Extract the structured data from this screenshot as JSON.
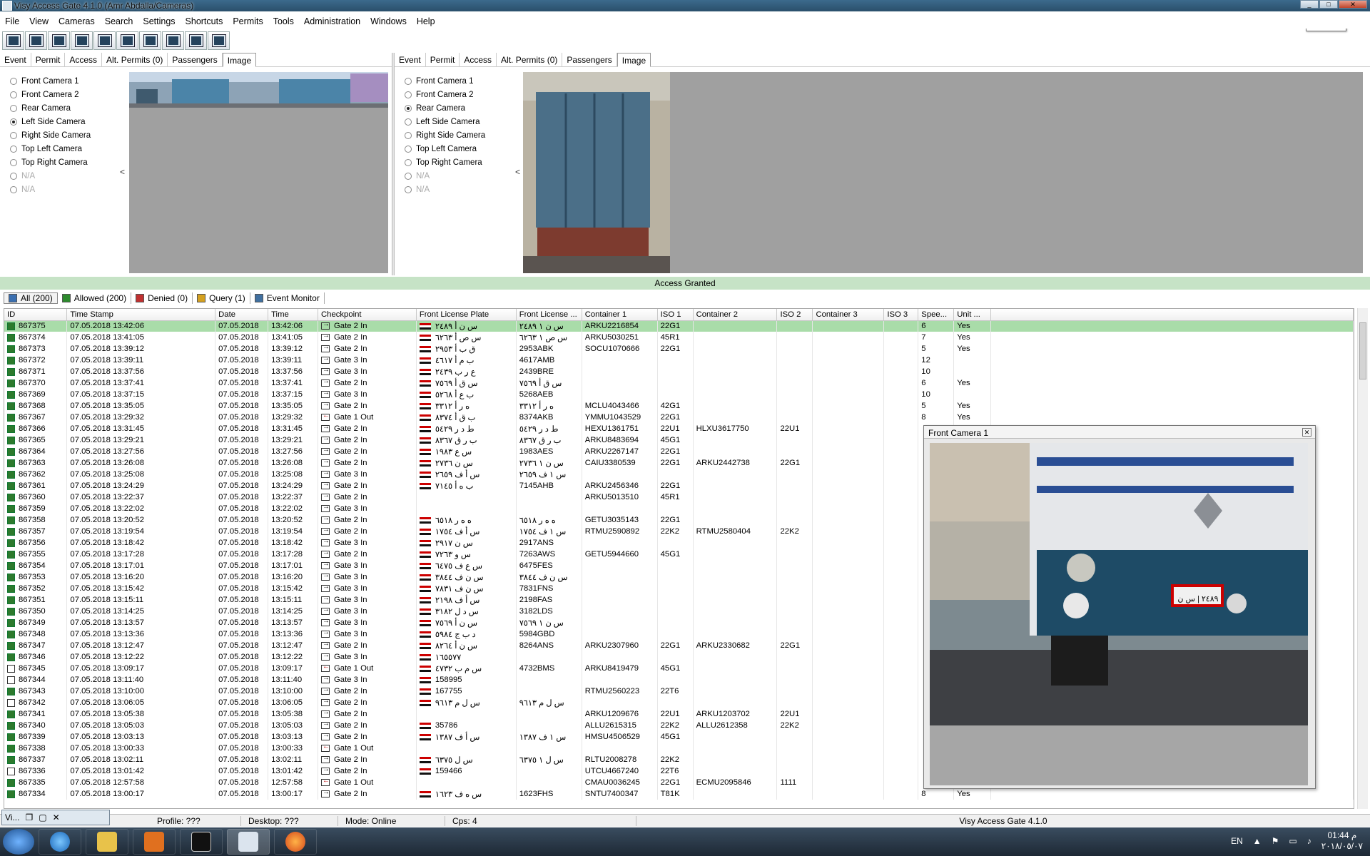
{
  "window": {
    "title": "Visy Access Gate 4.1.0 (Amr Abdalla/Cameras)",
    "tooltip": "Minimize"
  },
  "menu": [
    "File",
    "View",
    "Cameras",
    "Search",
    "Settings",
    "Shortcuts",
    "Permits",
    "Tools",
    "Administration",
    "Windows",
    "Help"
  ],
  "toolbar_icons": [
    "toolbar-icon-1",
    "toolbar-icon-2",
    "toolbar-icon-3",
    "toolbar-icon-4",
    "toolbar-icon-5",
    "toolbar-icon-6",
    "toolbar-icon-7",
    "toolbar-icon-8",
    "toolbar-icon-9",
    "toolbar-icon-10"
  ],
  "left_panel": {
    "tabs": [
      "Event",
      "Permit",
      "Access",
      "Alt. Permits (0)",
      "Passengers",
      "Image"
    ],
    "active_tab": "Image",
    "cameras": [
      "Front Camera 1",
      "Front Camera 2",
      "Rear Camera",
      "Left Side Camera",
      "Right Side Camera",
      "Top Left Camera",
      "Top Right Camera",
      "N/A",
      "N/A"
    ],
    "selected": "Left Side Camera"
  },
  "right_panel": {
    "tabs": [
      "Event",
      "Permit",
      "Access",
      "Alt. Permits (0)",
      "Passengers",
      "Image"
    ],
    "active_tab": "Image",
    "cameras": [
      "Front Camera 1",
      "Front Camera 2",
      "Rear Camera",
      "Left Side Camera",
      "Right Side Camera",
      "Top Left Camera",
      "Top Right Camera",
      "N/A",
      "N/A"
    ],
    "selected": "Rear Camera"
  },
  "collapse_glyph": "<",
  "banner": "Access Granted",
  "filters": [
    "All  (200)",
    "Allowed (200)",
    "Denied (0)",
    "Query (1)",
    "Event Monitor"
  ],
  "columns": [
    "ID",
    "Time Stamp",
    "Date",
    "Time",
    "Checkpoint",
    "Front License Plate",
    "Front License ...",
    "Container 1",
    "ISO 1",
    "Container 2",
    "ISO 2",
    "Container 3",
    "ISO 3",
    "Spee...",
    "Unit ..."
  ],
  "rows": [
    [
      "867375",
      "07.05.2018 13:42:06",
      "07.05.2018",
      "13:42:06",
      "Gate 2 In",
      "س ن أ ٢٤٨٩",
      "س ن ١ ٢٤٨٩",
      "ARKU2216854",
      "22G1",
      "",
      "",
      "",
      "",
      "6",
      "Yes"
    ],
    [
      "867374",
      "07.05.2018 13:41:05",
      "07.05.2018",
      "13:41:05",
      "Gate 2 In",
      "س ص أ ٦٢٦٣",
      "س ص ١ ٦٢٦٣",
      "ARKU5030251",
      "45R1",
      "",
      "",
      "",
      "",
      "7",
      "Yes"
    ],
    [
      "867373",
      "07.05.2018 13:39:12",
      "07.05.2018",
      "13:39:12",
      "Gate 2 In",
      "ق ب أ ٢٩٥٣",
      "2953ABK",
      "SOCU1070666",
      "22G1",
      "",
      "",
      "",
      "",
      "5",
      "Yes"
    ],
    [
      "867372",
      "07.05.2018 13:39:11",
      "07.05.2018",
      "13:39:11",
      "Gate 3 In",
      "ب م أ ٤٦١٧",
      "4617AMB",
      "",
      "",
      "",
      "",
      "",
      "",
      "12",
      ""
    ],
    [
      "867371",
      "07.05.2018 13:37:56",
      "07.05.2018",
      "13:37:56",
      "Gate 3 In",
      "ع ر ب ٢٤٣٩",
      "2439BRE",
      "",
      "",
      "",
      "",
      "",
      "",
      "10",
      ""
    ],
    [
      "867370",
      "07.05.2018 13:37:41",
      "07.05.2018",
      "13:37:41",
      "Gate 2 In",
      "س ق أ ٧٥٦٩",
      "س ق أ ٧٥٦٩",
      "",
      "",
      "",
      "",
      "",
      "",
      "6",
      "Yes"
    ],
    [
      "867369",
      "07.05.2018 13:37:15",
      "07.05.2018",
      "13:37:15",
      "Gate 3 In",
      "ب ع أ ٥٢٦٨",
      "5268AEB",
      "",
      "",
      "",
      "",
      "",
      "",
      "10",
      ""
    ],
    [
      "867368",
      "07.05.2018 13:35:05",
      "07.05.2018",
      "13:35:05",
      "Gate 2 In",
      "ه ر أ ٣٣١٢",
      "ه ر أ ٣٣١٢",
      "MCLU4043466",
      "42G1",
      "",
      "",
      "",
      "",
      "5",
      "Yes"
    ],
    [
      "867367",
      "07.05.2018 13:29:32",
      "07.05.2018",
      "13:29:32",
      "Gate 1 Out",
      "ب ق أ ٨٣٧٤",
      "8374AKB",
      "YMMU1043529",
      "22G1",
      "",
      "",
      "",
      "",
      "8",
      "Yes"
    ],
    [
      "867366",
      "07.05.2018 13:31:45",
      "07.05.2018",
      "13:31:45",
      "Gate 2 In",
      "ط د ر ٥٤٢٩",
      "ط د ر ٥٤٢٩",
      "HEXU1361751",
      "22U1",
      "HLXU3617750",
      "22U1",
      "",
      "",
      "",
      ""
    ],
    [
      "867365",
      "07.05.2018 13:29:21",
      "07.05.2018",
      "13:29:21",
      "Gate 2 In",
      "ب ر ق ٨٣٦٧",
      "ب ر ق ٨٣٦٧",
      "ARKU8483694",
      "45G1",
      "",
      "",
      "",
      "",
      "",
      ""
    ],
    [
      "867364",
      "07.05.2018 13:27:56",
      "07.05.2018",
      "13:27:56",
      "Gate 2 In",
      "س ع ١٩٨٣",
      "1983AES",
      "ARKU2267147",
      "22G1",
      "",
      "",
      "",
      "",
      "",
      ""
    ],
    [
      "867363",
      "07.05.2018 13:26:08",
      "07.05.2018",
      "13:26:08",
      "Gate 2 In",
      "س ن ٢٧٣٦",
      "س ن ١ ٢٧٣٦",
      "CAIU3380539",
      "22G1",
      "ARKU2442738",
      "22G1",
      "",
      "",
      "",
      ""
    ],
    [
      "867362",
      "07.05.2018 13:25:08",
      "07.05.2018",
      "13:25:08",
      "Gate 3 In",
      "س أ ف ٢٦٥٩",
      "س ١ ف ٢٦٥٩",
      "",
      "",
      "",
      "",
      "",
      "",
      "",
      ""
    ],
    [
      "867361",
      "07.05.2018 13:24:29",
      "07.05.2018",
      "13:24:29",
      "Gate 2 In",
      "ب ه أ ٧١٤٥",
      "7145AHB",
      "ARKU2456346",
      "22G1",
      "",
      "",
      "",
      "",
      "",
      ""
    ],
    [
      "867360",
      "07.05.2018 13:22:37",
      "07.05.2018",
      "13:22:37",
      "Gate 2 In",
      "",
      "",
      "ARKU5013510",
      "45R1",
      "",
      "",
      "",
      "",
      "",
      ""
    ],
    [
      "867359",
      "07.05.2018 13:22:02",
      "07.05.2018",
      "13:22:02",
      "Gate 3 In",
      "",
      "",
      "",
      "",
      "",
      "",
      "",
      "",
      "",
      ""
    ],
    [
      "867358",
      "07.05.2018 13:20:52",
      "07.05.2018",
      "13:20:52",
      "Gate 2 In",
      "ه ه ر ٦٥١٨",
      "ه ه ر ٦٥١٨",
      "GETU3035143",
      "22G1",
      "",
      "",
      "",
      "",
      "",
      ""
    ],
    [
      "867357",
      "07.05.2018 13:19:54",
      "07.05.2018",
      "13:19:54",
      "Gate 2 In",
      "س أ ف ١٧٥٤",
      "س ١ ف ١٧٥٤",
      "RTMU2590892",
      "22K2",
      "RTMU2580404",
      "22K2",
      "",
      "",
      "",
      ""
    ],
    [
      "867356",
      "07.05.2018 13:18:42",
      "07.05.2018",
      "13:18:42",
      "Gate 3 In",
      "س ن ٢٩١٧",
      "2917ANS",
      "",
      "",
      "",
      "",
      "",
      "",
      "",
      ""
    ],
    [
      "867355",
      "07.05.2018 13:17:28",
      "07.05.2018",
      "13:17:28",
      "Gate 2 In",
      "س و ٧٢٦٣",
      "7263AWS",
      "GETU5944660",
      "45G1",
      "",
      "",
      "",
      "",
      "",
      ""
    ],
    [
      "867354",
      "07.05.2018 13:17:01",
      "07.05.2018",
      "13:17:01",
      "Gate 3 In",
      "س ع ف ٦٤٧٥",
      "6475FES",
      "",
      "",
      "",
      "",
      "",
      "",
      "",
      ""
    ],
    [
      "867353",
      "07.05.2018 13:16:20",
      "07.05.2018",
      "13:16:20",
      "Gate 3 In",
      "س ن ف ٣٨٤٤",
      "س ن ف ٣٨٤٤",
      "",
      "",
      "",
      "",
      "",
      "",
      "",
      ""
    ],
    [
      "867352",
      "07.05.2018 13:15:42",
      "07.05.2018",
      "13:15:42",
      "Gate 3 In",
      "س ن ف ٧٨٣١",
      "7831FNS",
      "",
      "",
      "",
      "",
      "",
      "",
      "",
      ""
    ],
    [
      "867351",
      "07.05.2018 13:15:11",
      "07.05.2018",
      "13:15:11",
      "Gate 3 In",
      "س أ ف ٢١٩٨",
      "2198FAS",
      "",
      "",
      "",
      "",
      "",
      "",
      "",
      ""
    ],
    [
      "867350",
      "07.05.2018 13:14:25",
      "07.05.2018",
      "13:14:25",
      "Gate 3 In",
      "س د ل ٣١٨٢",
      "3182LDS",
      "",
      "",
      "",
      "",
      "",
      "",
      "",
      ""
    ],
    [
      "867349",
      "07.05.2018 13:13:57",
      "07.05.2018",
      "13:13:57",
      "Gate 3 In",
      "س ن أ ٧٥٦٩",
      "س ن ١ ٧٥٦٩",
      "",
      "",
      "",
      "",
      "",
      "",
      "",
      ""
    ],
    [
      "867348",
      "07.05.2018 13:13:36",
      "07.05.2018",
      "13:13:36",
      "Gate 3 In",
      "د ب ج ٥٩٨٤",
      "5984GBD",
      "",
      "",
      "",
      "",
      "",
      "",
      "",
      ""
    ],
    [
      "867347",
      "07.05.2018 13:12:47",
      "07.05.2018",
      "13:12:47",
      "Gate 2 In",
      "س ن أ ٨٢٦٤",
      "8264ANS",
      "ARKU2307960",
      "22G1",
      "ARKU2330682",
      "22G1",
      "",
      "",
      "",
      ""
    ],
    [
      "867346",
      "07.05.2018 13:12:22",
      "07.05.2018",
      "13:12:22",
      "Gate 3 In",
      "١٦٥٥٧٧",
      "",
      "",
      "",
      "",
      "",
      "",
      "",
      "",
      ""
    ],
    [
      "867345",
      "07.05.2018 13:09:17",
      "07.05.2018",
      "13:09:17",
      "Gate 1 Out",
      "س م ب ٤٧٣٢",
      "4732BMS",
      "ARKU8419479",
      "45G1",
      "",
      "",
      "",
      "",
      "",
      ""
    ],
    [
      "867344",
      "07.05.2018 13:11:40",
      "07.05.2018",
      "13:11:40",
      "Gate 3 In",
      "158995",
      "",
      "",
      "",
      "",
      "",
      "",
      "",
      "",
      ""
    ],
    [
      "867343",
      "07.05.2018 13:10:00",
      "07.05.2018",
      "13:10:00",
      "Gate 2 In",
      "167755",
      "",
      "RTMU2560223",
      "22T6",
      "",
      "",
      "",
      "",
      "",
      ""
    ],
    [
      "867342",
      "07.05.2018 13:06:05",
      "07.05.2018",
      "13:06:05",
      "Gate 2 In",
      "س ل م ٩٦١٣",
      "س ل م ٩٦١٣",
      "",
      "",
      "",
      "",
      "",
      "",
      "",
      ""
    ],
    [
      "867341",
      "07.05.2018 13:05:38",
      "07.05.2018",
      "13:05:38",
      "Gate 2 In",
      "",
      "",
      "ARKU1209676",
      "22U1",
      "ARKU1203702",
      "22U1",
      "",
      "",
      "",
      ""
    ],
    [
      "867340",
      "07.05.2018 13:05:03",
      "07.05.2018",
      "13:05:03",
      "Gate 2 In",
      "35786",
      "",
      "ALLU2615315",
      "22K2",
      "ALLU2612358",
      "22K2",
      "",
      "",
      "",
      ""
    ],
    [
      "867339",
      "07.05.2018 13:03:13",
      "07.05.2018",
      "13:03:13",
      "Gate 2 In",
      "س أ ف ١٣٨٧",
      "س ١ ف ١٣٨٧",
      "HMSU4506529",
      "45G1",
      "",
      "",
      "",
      "",
      "",
      ""
    ],
    [
      "867338",
      "07.05.2018 13:00:33",
      "07.05.2018",
      "13:00:33",
      "Gate 1 Out",
      "",
      "",
      "",
      "",
      "",
      "",
      "",
      "",
      "",
      ""
    ],
    [
      "867337",
      "07.05.2018 13:02:11",
      "07.05.2018",
      "13:02:11",
      "Gate 2 In",
      "س ل ٦٣٧٥",
      "س ل ١ ٦٣٧٥",
      "RLTU2008278",
      "22K2",
      "",
      "",
      "",
      "",
      "",
      ""
    ],
    [
      "867336",
      "07.05.2018 13:01:42",
      "07.05.2018",
      "13:01:42",
      "Gate 2 In",
      "159466",
      "",
      "UTCU4667240",
      "22T6",
      "",
      "",
      "",
      "",
      "",
      ""
    ],
    [
      "867335",
      "07.05.2018 12:57:58",
      "07.05.2018",
      "12:57:58",
      "Gate 1 Out",
      "",
      "",
      "CMAU0036245",
      "22G1",
      "ECMU2095846",
      "1111",
      "",
      "",
      "",
      ""
    ],
    [
      "867334",
      "07.05.2018 13:00:17",
      "07.05.2018",
      "13:00:17",
      "Gate 2 In",
      "س ه ف ١٦٢٣",
      "1623FHS",
      "SNTU7400347",
      "T81K",
      "",
      "",
      "",
      "",
      "8",
      "Yes"
    ]
  ],
  "camera_window": {
    "title": "Front Camera 1",
    "plate_text": "٢٤٨٩ | س ن"
  },
  "status": {
    "profile": "Profile: ???",
    "desktop": "Desktop: ???",
    "mode": "Mode: Online",
    "cps": "Cps: 4",
    "app": "Visy Access Gate 4.1.0"
  },
  "mini_window": {
    "label": "Vi..."
  },
  "tray": {
    "lang": "EN",
    "time": "01:44 م",
    "date": "٢٠١٨/٠٥/٠٧"
  }
}
